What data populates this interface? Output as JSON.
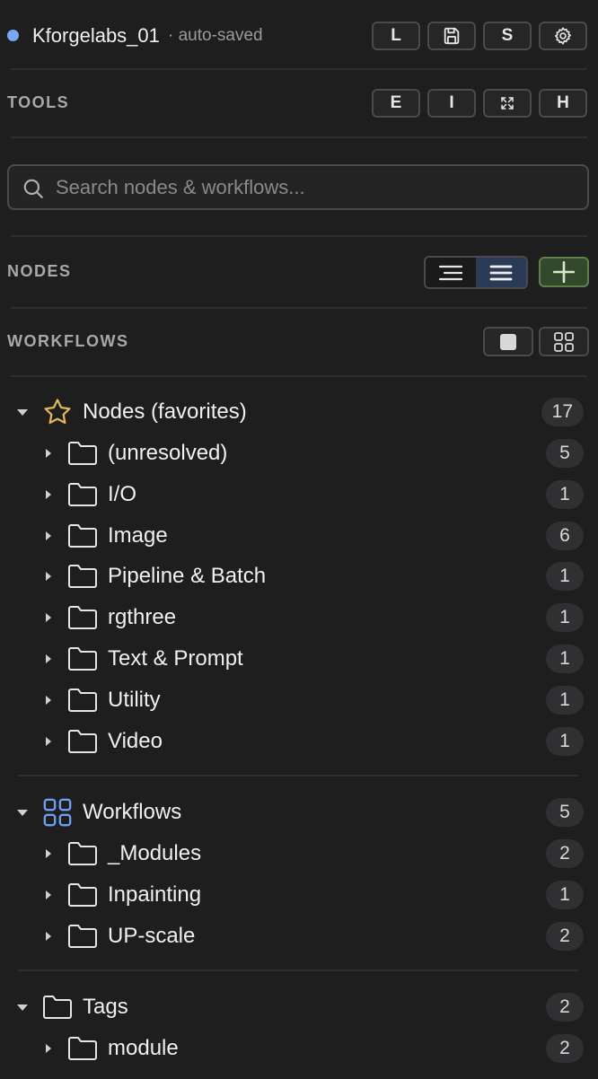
{
  "header": {
    "project_name": "Kforgelabs_01",
    "autosave_status": "· auto-saved",
    "buttons": {
      "l": "L",
      "s": "S"
    }
  },
  "tools": {
    "label": "TOOLS",
    "buttons": {
      "e": "E",
      "i": "I",
      "h": "H"
    }
  },
  "search": {
    "placeholder": "Search nodes & workflows..."
  },
  "nodes_section": {
    "label": "NODES"
  },
  "workflows_section": {
    "label": "WORKFLOWS"
  },
  "tree": {
    "favorites": {
      "label": "Nodes (favorites)",
      "count": "17",
      "children": [
        {
          "label": "(unresolved)",
          "count": "5"
        },
        {
          "label": "I/O",
          "count": "1"
        },
        {
          "label": "Image",
          "count": "6"
        },
        {
          "label": "Pipeline & Batch",
          "count": "1"
        },
        {
          "label": "rgthree",
          "count": "1"
        },
        {
          "label": "Text & Prompt",
          "count": "1"
        },
        {
          "label": "Utility",
          "count": "1"
        },
        {
          "label": "Video",
          "count": "1"
        }
      ]
    },
    "workflows": {
      "label": "Workflows",
      "count": "5",
      "children": [
        {
          "label": "_Modules",
          "count": "2"
        },
        {
          "label": "Inpainting",
          "count": "1"
        },
        {
          "label": "UP-scale",
          "count": "2"
        }
      ]
    },
    "tags": {
      "label": "Tags",
      "count": "2",
      "children": [
        {
          "label": "module",
          "count": "2"
        }
      ]
    }
  },
  "colors": {
    "background": "#1e1e1f",
    "status_dot": "#7aa7f2",
    "favorite_star": "#e5b454",
    "workflows_icon": "#6d9cf0",
    "add_button": "#34492c"
  }
}
